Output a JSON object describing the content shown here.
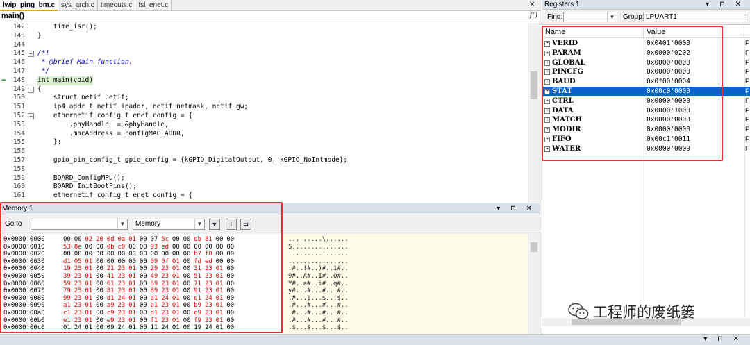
{
  "editor": {
    "tabs": [
      {
        "label": "lwip_ping_bm.c",
        "active": true
      },
      {
        "label": "sys_arch.c",
        "active": false
      },
      {
        "label": "timeouts.c",
        "active": false
      },
      {
        "label": "fsl_enet.c",
        "active": false
      }
    ],
    "close_label": "✕",
    "function_name": "main()",
    "func_icon": "f()",
    "lines": [
      {
        "n": "142",
        "t": "    time_isr();"
      },
      {
        "n": "143",
        "t": "}",
        "fold": ""
      },
      {
        "n": "144",
        "t": ""
      },
      {
        "n": "145",
        "t": "/*!",
        "fold": "−",
        "cmt": true
      },
      {
        "n": "146",
        "t": " * @brief Main function.",
        "cmt": true
      },
      {
        "n": "147",
        "t": " */",
        "cmt": true
      },
      {
        "n": "148",
        "t": "int main(void)",
        "hl": true,
        "arrow": true
      },
      {
        "n": "149",
        "t": "{",
        "fold": "−"
      },
      {
        "n": "150",
        "t": "    struct netif netif;"
      },
      {
        "n": "151",
        "t": "    ip4_addr_t netif_ipaddr, netif_netmask, netif_gw;"
      },
      {
        "n": "152",
        "t": "    ethernetif_config_t enet_config = {",
        "fold": "−"
      },
      {
        "n": "153",
        "t": "        .phyHandle  = &phyHandle,"
      },
      {
        "n": "154",
        "t": "        .macAddress = configMAC_ADDR,"
      },
      {
        "n": "155",
        "t": "    };"
      },
      {
        "n": "156",
        "t": ""
      },
      {
        "n": "157",
        "t": "    gpio_pin_config_t gpio_config = {kGPIO_DigitalOutput, 0, kGPIO_NoIntmode};"
      },
      {
        "n": "158",
        "t": ""
      },
      {
        "n": "159",
        "t": "    BOARD_ConfigMPU();"
      },
      {
        "n": "160",
        "t": "    BOARD_InitBootPins();"
      },
      {
        "n": "161",
        "t": "    ethernetif_config_t enet_config = {"
      }
    ]
  },
  "memory": {
    "title": "Memory 1",
    "title_buttons": "▾ ⊓ ✕",
    "goto_label": "Go to",
    "goto_value": "",
    "view_mode": "Memory",
    "toolbar_icons": [
      "dropdown-icon",
      "pin-icon",
      "refresh-icon"
    ],
    "rows": [
      {
        "addr": "0x0000'0000",
        "bytes": [
          "00",
          "00",
          "02",
          "20",
          "0d",
          "0a",
          "01",
          "00",
          "07",
          "5c",
          "00",
          "00",
          "db",
          "81",
          "00",
          "00"
        ],
        "red": [
          2,
          3,
          4,
          5,
          6,
          9,
          12,
          13
        ],
        "ascii": "... .....\\......"
      },
      {
        "addr": "0x0000'0010",
        "bytes": [
          "53",
          "8e",
          "00",
          "00",
          "0b",
          "c0",
          "00",
          "00",
          "93",
          "ed",
          "00",
          "00",
          "00",
          "00",
          "00",
          "00"
        ],
        "red": [
          0,
          1,
          4,
          5,
          8,
          9
        ],
        "ascii": "S..............."
      },
      {
        "addr": "0x0000'0020",
        "bytes": [
          "00",
          "00",
          "00",
          "00",
          "00",
          "00",
          "00",
          "00",
          "00",
          "00",
          "00",
          "00",
          "b7",
          "f0",
          "00",
          "00"
        ],
        "red": [
          12,
          13
        ],
        "ascii": "................"
      },
      {
        "addr": "0x0000'0030",
        "bytes": [
          "d1",
          "05",
          "01",
          "00",
          "00",
          "00",
          "00",
          "00",
          "09",
          "0f",
          "01",
          "00",
          "fd",
          "ed",
          "00",
          "00"
        ],
        "red": [
          0,
          1,
          2,
          8,
          9,
          10,
          12,
          13
        ],
        "ascii": "................"
      },
      {
        "addr": "0x0000'0040",
        "bytes": [
          "19",
          "23",
          "01",
          "00",
          "21",
          "23",
          "01",
          "00",
          "29",
          "23",
          "01",
          "00",
          "31",
          "23",
          "01",
          "00"
        ],
        "red": [
          0,
          1,
          2,
          4,
          5,
          6,
          8,
          9,
          10,
          12,
          13,
          14
        ],
        "ascii": ".#..!#..)#..1#.."
      },
      {
        "addr": "0x0000'0050",
        "bytes": [
          "39",
          "23",
          "01",
          "00",
          "41",
          "23",
          "01",
          "00",
          "49",
          "23",
          "01",
          "00",
          "51",
          "23",
          "01",
          "00"
        ],
        "red": [
          0,
          1,
          2,
          4,
          5,
          6,
          8,
          9,
          10,
          12,
          13,
          14
        ],
        "ascii": "9#..A#..I#..Q#.."
      },
      {
        "addr": "0x0000'0060",
        "bytes": [
          "59",
          "23",
          "01",
          "00",
          "61",
          "23",
          "01",
          "00",
          "69",
          "23",
          "01",
          "00",
          "71",
          "23",
          "01",
          "00"
        ],
        "red": [
          0,
          1,
          2,
          4,
          5,
          6,
          8,
          9,
          10,
          12,
          13,
          14
        ],
        "ascii": "Y#..a#..i#..q#.."
      },
      {
        "addr": "0x0000'0070",
        "bytes": [
          "79",
          "23",
          "01",
          "00",
          "81",
          "23",
          "01",
          "00",
          "89",
          "23",
          "01",
          "00",
          "91",
          "23",
          "01",
          "00"
        ],
        "red": [
          0,
          1,
          2,
          4,
          5,
          6,
          8,
          9,
          10,
          12,
          13,
          14
        ],
        "ascii": "y#...#...#...#.."
      },
      {
        "addr": "0x0000'0080",
        "bytes": [
          "99",
          "23",
          "01",
          "00",
          "d1",
          "24",
          "01",
          "00",
          "d1",
          "24",
          "01",
          "00",
          "d1",
          "24",
          "01",
          "00"
        ],
        "red": [
          0,
          1,
          2,
          4,
          5,
          6,
          8,
          9,
          10,
          12,
          13,
          14
        ],
        "ascii": ".#...$...$...$.."
      },
      {
        "addr": "0x0000'0090",
        "bytes": [
          "a1",
          "23",
          "01",
          "00",
          "a9",
          "23",
          "01",
          "00",
          "b1",
          "23",
          "01",
          "00",
          "b9",
          "23",
          "01",
          "00"
        ],
        "red": [
          0,
          1,
          2,
          4,
          5,
          6,
          8,
          9,
          10,
          12,
          13,
          14
        ],
        "ascii": ".#...#...#...#.."
      },
      {
        "addr": "0x0000'00a0",
        "bytes": [
          "c1",
          "23",
          "01",
          "00",
          "c9",
          "23",
          "01",
          "00",
          "d1",
          "23",
          "01",
          "00",
          "d9",
          "23",
          "01",
          "00"
        ],
        "red": [
          0,
          1,
          2,
          4,
          5,
          6,
          8,
          9,
          10,
          12,
          13,
          14
        ],
        "ascii": ".#...#...#...#.."
      },
      {
        "addr": "0x0000'00b0",
        "bytes": [
          "e1",
          "23",
          "01",
          "00",
          "e9",
          "23",
          "01",
          "00",
          "f1",
          "23",
          "01",
          "00",
          "f9",
          "23",
          "01",
          "00"
        ],
        "red": [
          0,
          1,
          2,
          4,
          5,
          6,
          8,
          9,
          10,
          12,
          13,
          14
        ],
        "ascii": ".#...#...#...#.."
      },
      {
        "addr": "0x0000'00c0",
        "bytes": [
          "01",
          "24",
          "01",
          "00",
          "09",
          "24",
          "01",
          "00",
          "11",
          "24",
          "01",
          "00",
          "19",
          "24",
          "01",
          "00"
        ],
        "red": [],
        "ascii": ".$...$...$...$.."
      }
    ]
  },
  "registers": {
    "title": "Registers 1",
    "title_buttons": "▾ ⊓ ✕",
    "find_label": "Find:",
    "find_value": "",
    "group_label": "Group:",
    "group_value": "LPUART1",
    "col_name": "Name",
    "col_value": "Value",
    "col3_marker": "F",
    "rows": [
      {
        "name": "VERID",
        "value": "0x0401'0003"
      },
      {
        "name": "PARAM",
        "value": "0x0000'0202"
      },
      {
        "name": "GLOBAL",
        "value": "0x0000'0000"
      },
      {
        "name": "PINCFG",
        "value": "0x0000'0000"
      },
      {
        "name": "BAUD",
        "value": "0x0f00'0004"
      },
      {
        "name": "STAT",
        "value": "0x00c0'0000",
        "selected": true
      },
      {
        "name": "CTRL",
        "value": "0x0000'0000"
      },
      {
        "name": "DATA",
        "value": "0x0000'1000"
      },
      {
        "name": "MATCH",
        "value": "0x0000'0000"
      },
      {
        "name": "MODIR",
        "value": "0x0000'0000"
      },
      {
        "name": "FIFO",
        "value": "0x00c1'0011"
      },
      {
        "name": "WATER",
        "value": "0x0000'0000"
      }
    ]
  },
  "bottom_buttons": "▾ ⊓ ✕",
  "watermark": {
    "text": "工程师的废纸篓",
    "icon": "wechat-icon"
  },
  "colors": {
    "highlight_box": "#e43030",
    "selection": "#0a64c8",
    "changed_byte": "#e00000",
    "current_line": "#d8f0d0"
  }
}
